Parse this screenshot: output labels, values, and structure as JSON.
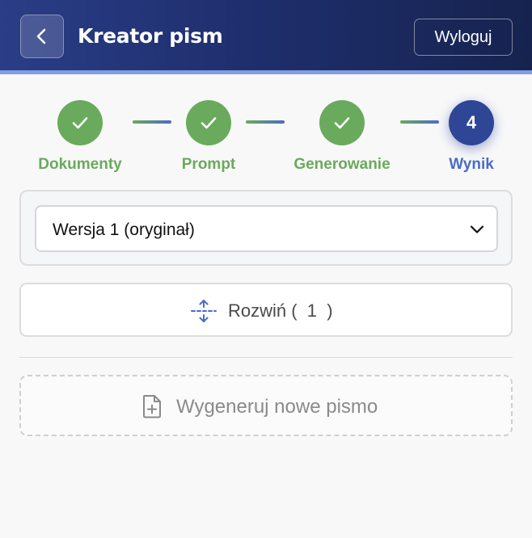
{
  "header": {
    "title": "Kreator pism",
    "back_icon": "chevron-left-icon",
    "logout_label": "Wyloguj",
    "colors": {
      "start": "#2a3d86",
      "end": "#16234f",
      "accent": "#7f9de0"
    }
  },
  "stepper": {
    "steps": [
      {
        "label": "Dokumenty",
        "state": "done",
        "icon": "check-icon"
      },
      {
        "label": "Prompt",
        "state": "done",
        "icon": "check-icon"
      },
      {
        "label": "Generowanie",
        "state": "done",
        "icon": "check-icon"
      },
      {
        "label": "Wynik",
        "state": "active",
        "number": "4"
      }
    ],
    "colors": {
      "done": "#6aaa5c",
      "active": "#2f4596",
      "active_label": "#4a6bc6"
    }
  },
  "version": {
    "selected": "Wersja 1 (oryginał)",
    "icon": "chevron-down-icon"
  },
  "expand": {
    "label": "Rozwiń (  1  )",
    "icon": "expand-vertical-icon"
  },
  "generate": {
    "label": "Wygeneruj nowe pismo",
    "icon": "file-plus-icon"
  }
}
